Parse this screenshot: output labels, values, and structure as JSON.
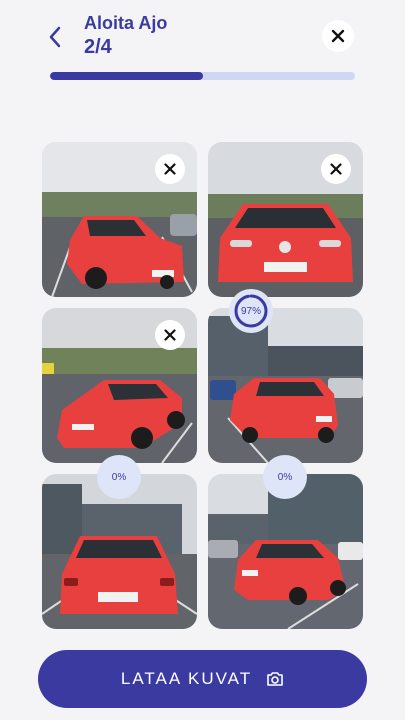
{
  "header": {
    "title": "Aloita Ajo",
    "step": "2/4",
    "progress": 0.5
  },
  "photos": [
    {
      "id": "front-left",
      "removable": true
    },
    {
      "id": "front",
      "removable": true
    },
    {
      "id": "left-side",
      "removable": true
    },
    {
      "id": "rear-left",
      "removable": false
    },
    {
      "id": "rear",
      "removable": false
    },
    {
      "id": "rear-right",
      "removable": false
    }
  ],
  "uploads": [
    {
      "label": "97%",
      "progress": 0.97
    },
    {
      "label": "0%",
      "progress": 0
    },
    {
      "label": "0%",
      "progress": 0
    }
  ],
  "upload_button": {
    "label": "LATAA KUVAT"
  },
  "colors": {
    "accent": "#3a3aa0",
    "track": "#cfd7f5",
    "car": "#e8403f"
  }
}
